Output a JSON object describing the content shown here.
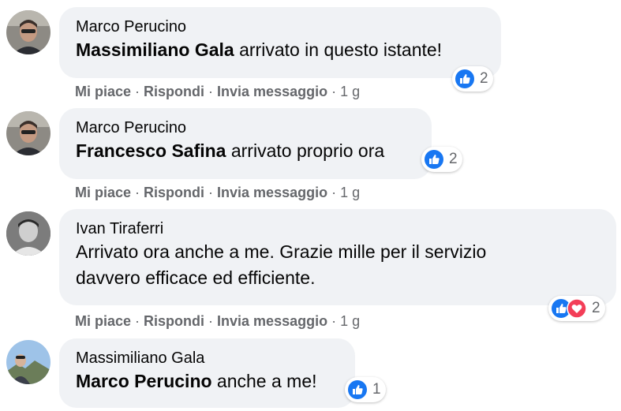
{
  "comments": [
    {
      "author": "Marco Perucino",
      "mention": "Massimiliano Gala",
      "text": " arrivato in questo istante!",
      "reaction_count": "2",
      "reactions": [
        "like-icon"
      ]
    },
    {
      "author": "Marco Perucino",
      "mention": "Francesco Safina",
      "text": " arrivato proprio ora",
      "reaction_count": "2",
      "reactions": [
        "like-icon"
      ]
    },
    {
      "author": "Ivan Tiraferri",
      "mention": "",
      "text_line1": "Arrivato ora anche a me. Grazie mille per il servizio",
      "text_line2": "davvero efficace ed efficiente.",
      "reaction_count": "2",
      "reactions": [
        "like-icon",
        "love-icon"
      ]
    },
    {
      "author": "Massimiliano Gala",
      "mention": "Marco Perucino",
      "text": " anche a me!",
      "reaction_count": "1",
      "reactions": [
        "like-icon"
      ]
    }
  ],
  "actions": {
    "like": "Mi piace",
    "reply": "Rispondi",
    "message": "Invia messaggio",
    "separator": "·",
    "time": "1 g"
  },
  "colors": {
    "bubble": "#f0f2f5",
    "like_blue": "#1877f2",
    "love_red": "#f33e58",
    "meta_gray": "#65676b"
  }
}
